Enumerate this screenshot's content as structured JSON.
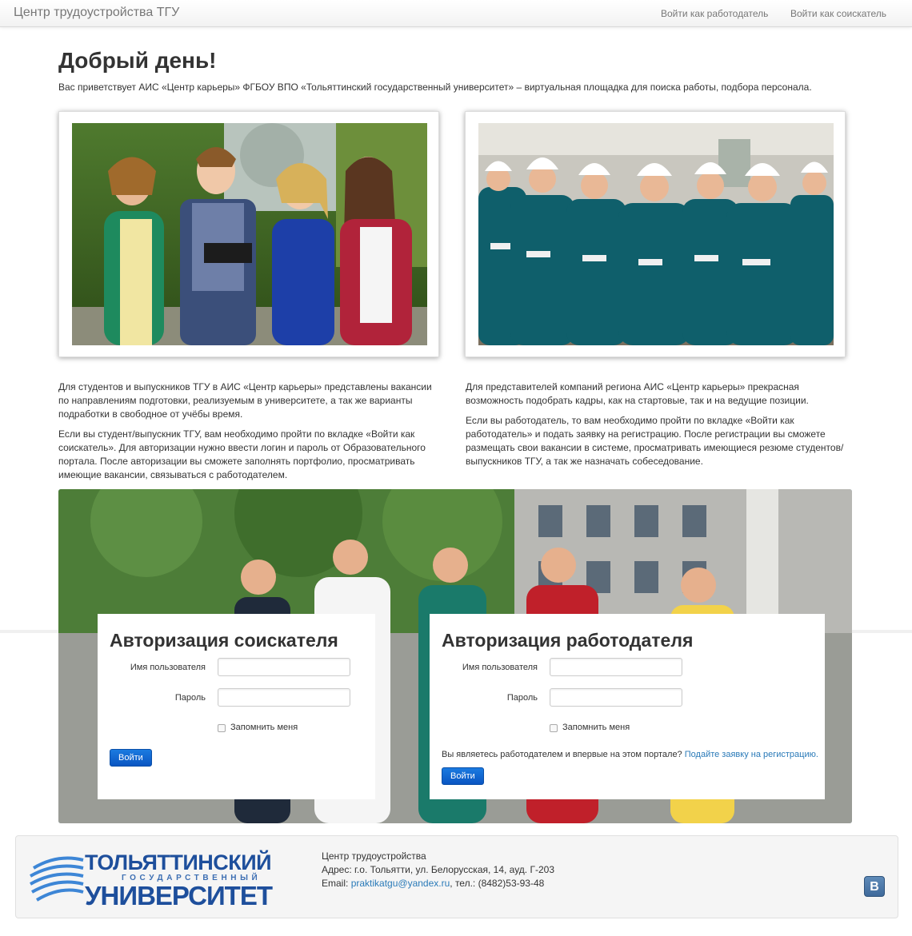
{
  "navbar": {
    "brand": "Центр трудоустройства ТГУ",
    "links": [
      "Войти как работодатель",
      "Войти как соискатель"
    ]
  },
  "intro": {
    "heading": "Добрый день!",
    "text": "Вас приветствует АИС «Центр карьеры» ФГБОУ ВПО «Тольяттинский государственный университет» – виртуальная площадка для поиска работы, подбора персонала."
  },
  "columns": {
    "left": [
      "Для студентов и выпускников ТГУ в АИС «Центр карьеры» представлены вакансии по направлениям подготовки, реализуемым в университете, а так же варианты подработки в свободное от учёбы время.",
      "Если вы студент/выпускник ТГУ, вам необходимо пройти по вкладке «Войти как соискатель». Для авторизации нужно ввести логин и пароль от Образовательного портала. После авторизации вы сможете заполнять портфолио, просматривать имеющие вакансии, связываться с работодателем."
    ],
    "right": [
      "Для представителей компаний региона АИС «Центр карьеры» прекрасная возможность подобрать кадры, как на стартовые, так и на ведущие позиции.",
      "Если вы работодатель, то вам необходимо пройти по вкладке «Войти как работодатель» и подать заявку на регистрацию. После регистрации вы сможете размещать свои вакансии в системе, просматривать имеющиеся резюме студентов/выпускников ТГУ, а так же назначать собеседование."
    ]
  },
  "seeker_login": {
    "title": "Авторизация соискателя",
    "username_label": "Имя пользователя",
    "username_value": "",
    "password_label": "Пароль",
    "password_value": "",
    "remember_label": "Запомнить меня",
    "submit_label": "Войти"
  },
  "employer_login": {
    "title": "Авторизация работодателя",
    "username_label": "Имя пользователя",
    "username_value": "",
    "password_label": "Пароль",
    "password_value": "",
    "remember_label": "Запомнить меня",
    "question": "Вы являетесь работодателем и впервые на этом портале?",
    "register_link": "Подайте заявку на регистрацию.",
    "submit_label": "Войти"
  },
  "footer": {
    "logo_line1": "ТОЛЬЯТТИНСКИЙ",
    "logo_line2": "ГОСУДАРСТВЕННЫЙ",
    "logo_line3": "УНИВЕРСИТЕТ",
    "center_link": "Центр трудоустройства",
    "address": "Адрес: г.о. Тольятти, ул. Белорусская, 14, ауд. Г-203",
    "email_label": "Email:",
    "email": "praktikatgu@yandex.ru",
    "phone": ", тел.: (8482)53-93-48",
    "social_icon": "vk-icon",
    "social_glyph": "B"
  },
  "colors": {
    "accent": "#0a55c2",
    "link": "#2a7ab8",
    "logo_blue": "#1e4f9c"
  }
}
